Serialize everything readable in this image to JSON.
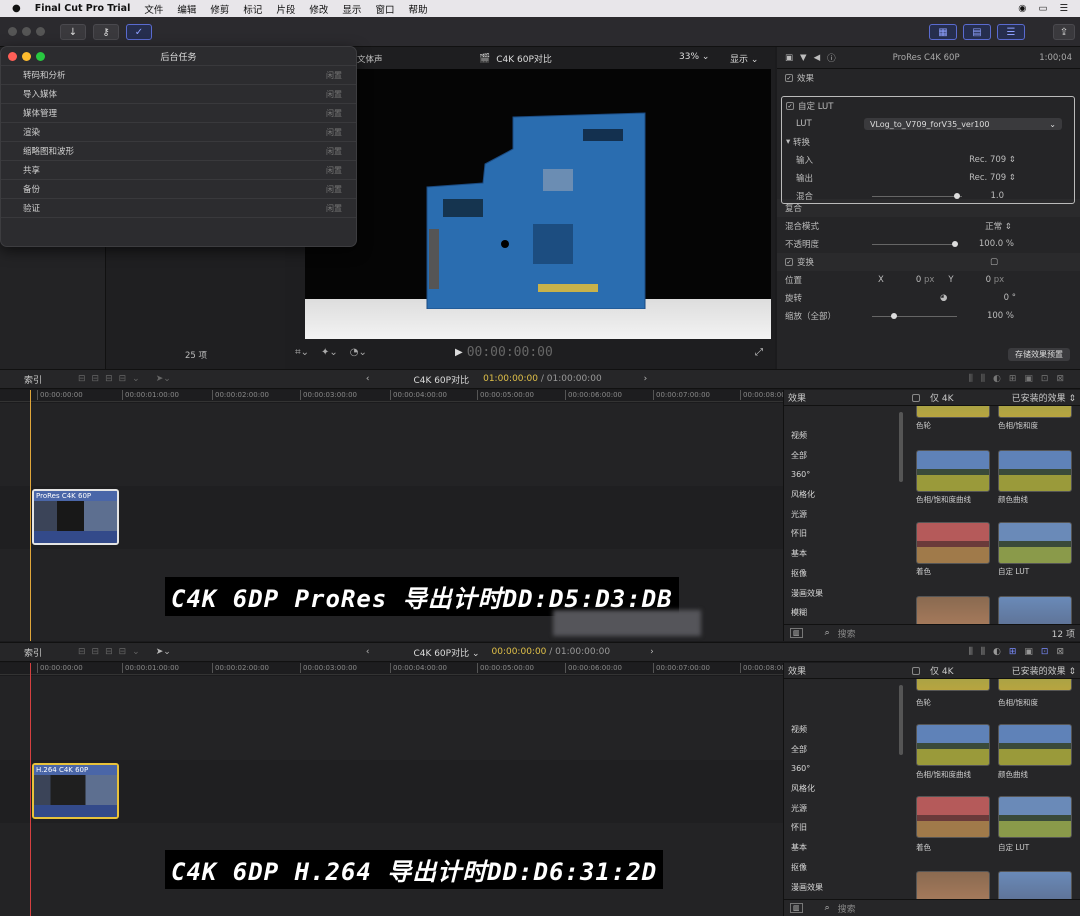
{
  "menubar": {
    "apple": "",
    "app": "Final Cut Pro Trial",
    "items": [
      "文件",
      "编辑",
      "修剪",
      "标记",
      "片段",
      "修改",
      "显示",
      "窗口",
      "帮助"
    ]
  },
  "background_tasks": {
    "title": "后台任务",
    "rows": [
      {
        "name": "转码和分析",
        "status": "闲置"
      },
      {
        "name": "导入媒体",
        "status": "闲置"
      },
      {
        "name": "媒体管理",
        "status": "闲置"
      },
      {
        "name": "渲染",
        "status": "闲置"
      },
      {
        "name": "缩略图和波形",
        "status": "闲置"
      },
      {
        "name": "共享",
        "status": "闲置"
      },
      {
        "name": "备份",
        "status": "闲置"
      },
      {
        "name": "验证",
        "status": "闲置"
      }
    ]
  },
  "browser": {
    "item_count": "25 项"
  },
  "viewer": {
    "audio_label": "文体声",
    "clip_title": "C4K 60P对比",
    "zoom": "33%",
    "display": "显示",
    "timecode": "00:00:00:00"
  },
  "inspector": {
    "clip_name": "ProRes C4K 60P",
    "duration": "1:00;04",
    "effects_label": "效果",
    "custom_lut": "自定 LUT",
    "lut_label": "LUT",
    "lut_value": "VLog_to_V709_forV35_ver100",
    "convert": "转换",
    "input_label": "输入",
    "input_value": "Rec. 709",
    "output_label": "输出",
    "output_value": "Rec. 709",
    "mix_label": "混合",
    "mix_value": "1.0",
    "composite": "复合",
    "blend_label": "混合模式",
    "blend_value": "正常",
    "opacity_label": "不透明度",
    "opacity_value": "100.0 %",
    "transform": "变换",
    "position_label": "位置",
    "x_label": "X",
    "x_value": "0",
    "y_label": "Y",
    "y_value": "0",
    "px": "px",
    "rotation_label": "旋转",
    "rotation_value": "0",
    "deg": "°",
    "scale_label": "缩放（全部）",
    "scale_value": "100",
    "pct": "%",
    "save_preset": "存储效果预置"
  },
  "timeline1": {
    "index": "索引",
    "project": "C4K 60P对比",
    "tc_current": "01:00:00:00",
    "tc_total": "01:00:00:00",
    "clip": "ProRes C4K 60P",
    "overlay": "C4K 6DP ProRes 导出计时DD:D5:D3:DB"
  },
  "timeline2": {
    "index": "索引",
    "project": "C4K 60P对比",
    "tc_current": "00:00:00:00",
    "tc_total": "01:00:00:00",
    "clip": "H.264 C4K 60P",
    "overlay": "C4K 6DP H.264 导出计时DD:D6:31:2D"
  },
  "ruler": [
    "00:00:00:00",
    "00:00:01:00:00",
    "00:00:02:00:00",
    "00:00:03:00:00",
    "00:00:04:00:00",
    "00:00:05:00:00",
    "00:00:06:00:00",
    "00:00:07:00:00",
    "00:00:08:00"
  ],
  "effects": {
    "title": "效果",
    "only4k": "仅 4K",
    "installed": "已安装的效果",
    "search": "搜索",
    "count": "12 项",
    "categories": [
      "视频",
      "全部",
      "360°",
      "风格化",
      "光源",
      "怀旧",
      "基本",
      "抠像",
      "漫画效果",
      "模糊"
    ],
    "thumbs": [
      {
        "label": "色轮"
      },
      {
        "label": "色相/饱和度"
      },
      {
        "label": "色相/饱和度曲线"
      },
      {
        "label": "颜色曲线"
      },
      {
        "label": "着色"
      },
      {
        "label": "自定 LUT"
      }
    ]
  },
  "colors": {
    "accent": "#4a66a8",
    "playhead": "#e0a63a",
    "playhead2": "#d54040"
  }
}
